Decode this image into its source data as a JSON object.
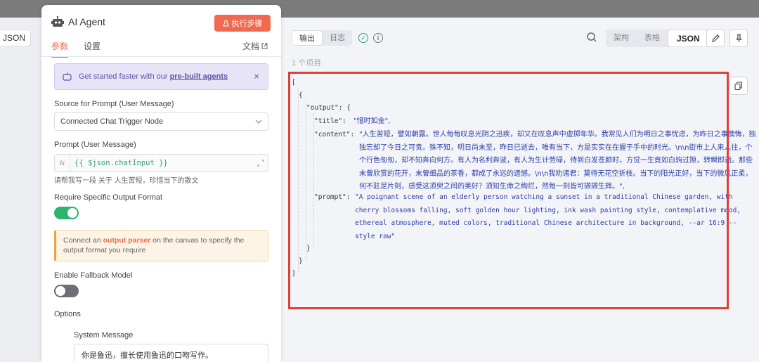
{
  "background": {
    "left_json_label": "JSON"
  },
  "node": {
    "title": "AI Agent",
    "execute_label": "执行步骤",
    "tabs": [
      "参数",
      "设置"
    ],
    "docs_label": "文档",
    "banner": {
      "prefix": "Get started faster with our",
      "link": "pre-built agents",
      "close": "×"
    },
    "source_label": "Source for Prompt (User Message)",
    "source_value": "Connected Chat Trigger Node",
    "prompt_label": "Prompt (User Message)",
    "prompt_fx": "fx",
    "prompt_value": "{{ $json.chatInput }}",
    "prompt_hint": "请帮我写一段 关于 人生苦短，珍惜当下的散文",
    "require_format_label": "Require Specific Output Format",
    "require_format_on": true,
    "warn": {
      "prefix": "Connect an",
      "link": "output parser",
      "suffix": "on the canvas to specify the output format you require"
    },
    "fallback_label": "Enable Fallback Model",
    "fallback_on": false,
    "options_label": "Options",
    "system_message_label": "System Message",
    "system_message_value": "你是鲁迅，擅长使用鲁迅的口吻写作。"
  },
  "output": {
    "tabs": [
      "输出",
      "日志"
    ],
    "view_options": [
      "架构",
      "表格",
      "JSON"
    ],
    "active_view": "JSON",
    "item_count": "1 个项目",
    "json": {
      "open_bracket": "[",
      "open_brace": "{",
      "output_key": "\"output\": {",
      "title_key": "\"title\":",
      "title_value": "\"惜时如金\",",
      "content_key": "\"content\":",
      "content_value": "\"人生苦短，譬如朝露。世人每每叹息光阴之迅疾，却又在叹息声中虚掷年华。我常见人们为明日之事忧虑，为昨日之事懊悔，独独忘却了今日之可贵。殊不知，明日尚未至，昨日已逝去，唯有当下，方是实实在在握于手中的时光。\\n\\n街市上人来人往，个个行色匆匆，却不知奔向何方。有人为名利奔波，有人为生计劳碌，待到白发苍颜时，方觉一生竟如白驹过隙，转瞬即逝。那些未曾欣赏的花开，未曾细品的茶香，都成了永远的遗憾。\\n\\n我劝诸君：莫待无花空折枝。当下的阳光正好，当下的微风正柔，何不驻足片刻，感受这须臾之间的美好？须知生命之绚烂，然每一刻皆可撷撷生辉。\",",
      "prompt_key": "\"prompt\":",
      "prompt_value": "\"A poignant scene of an elderly person watching a sunset in a traditional Chinese garden, with cherry blossoms falling, soft golden hour lighting, ink wash painting style, contemplative mood, ethereal atmosphere, muted colors, traditional Chinese architecture in background, --ar 16:9 --style raw\"",
      "close_inner": "}",
      "close_brace": "}",
      "close_bracket": "]"
    }
  },
  "colors": {
    "accent": "#f06a52",
    "toggle_on": "#2fb36c",
    "highlight_border": "#e0403a",
    "json_string": "#2b3ea8"
  }
}
